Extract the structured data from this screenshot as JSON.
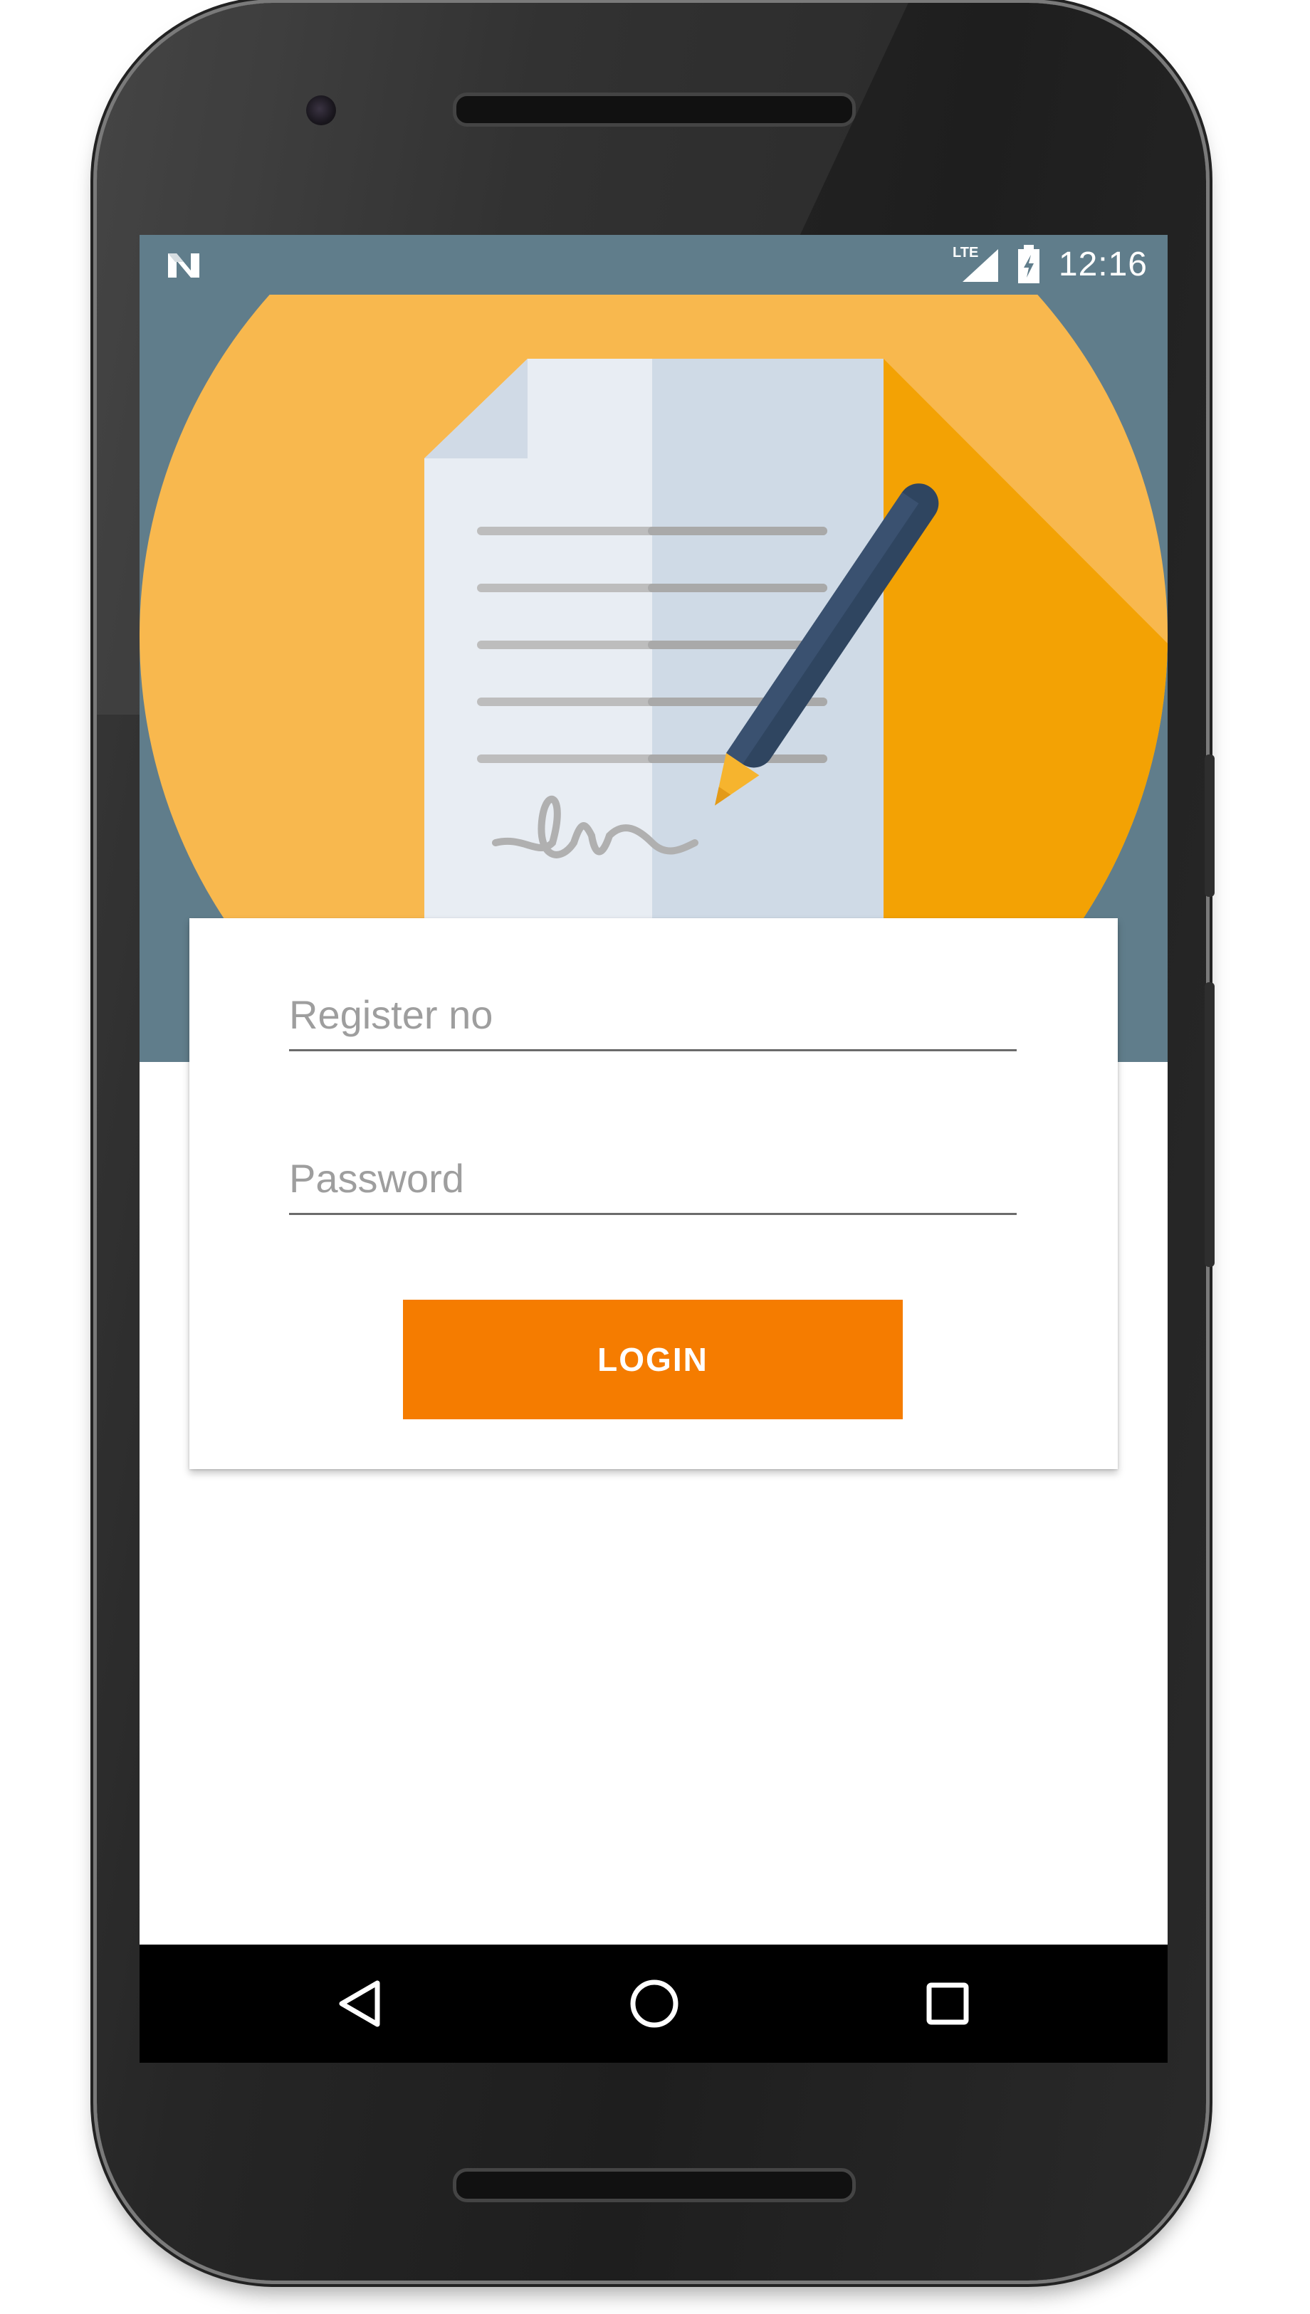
{
  "status_bar": {
    "network_label": "LTE",
    "time": "12:16"
  },
  "login_form": {
    "register_placeholder": "Register no",
    "password_placeholder": "Password",
    "login_label": "LOGIN"
  },
  "icons": {
    "notification": "n-logo-icon",
    "signal": "signal-icon",
    "battery": "battery-charging-icon",
    "header_image": "document-pencil-icon",
    "back": "back-triangle-icon",
    "home": "home-circle-icon",
    "recents": "recents-square-icon"
  },
  "colors": {
    "status_bar": "#607d8b",
    "accent": "#f57c00",
    "header_circle": "#f8b84e"
  }
}
